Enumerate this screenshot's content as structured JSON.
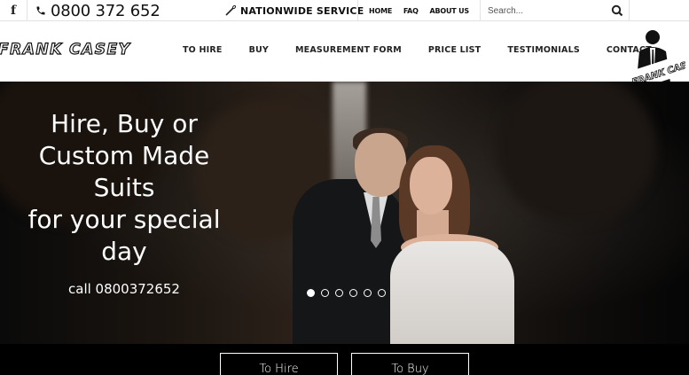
{
  "topbar": {
    "facebook_label": "f",
    "phone_icon": "phone-icon",
    "phone": "0800 372 652",
    "nationwide_icon": "needle-icon",
    "nationwide": "NATIONWIDE SERVICE",
    "links": [
      "HOME",
      "FAQ",
      "ABOUT US"
    ],
    "search_placeholder": "Search...",
    "search_icon": "search-icon"
  },
  "header": {
    "brand": "FRANK CASEY",
    "nav": [
      "TO HIRE",
      "BUY",
      "MEASUREMENT FORM",
      "PRICE LIST",
      "TESTIMONIALS",
      "CONTACT"
    ],
    "logo_text": "FRANK CASEY"
  },
  "hero": {
    "title_lines": [
      "Hire, Buy or",
      "Custom Made",
      "Suits",
      "for your special",
      "day"
    ],
    "call": "call 0800372652",
    "slides_total": 6,
    "active_slide": 1
  },
  "cta": {
    "hire": "To Hire",
    "buy": "To Buy"
  },
  "colors": {
    "background": "#000000",
    "header_bg": "#ffffff",
    "text_light": "#ffffff"
  }
}
